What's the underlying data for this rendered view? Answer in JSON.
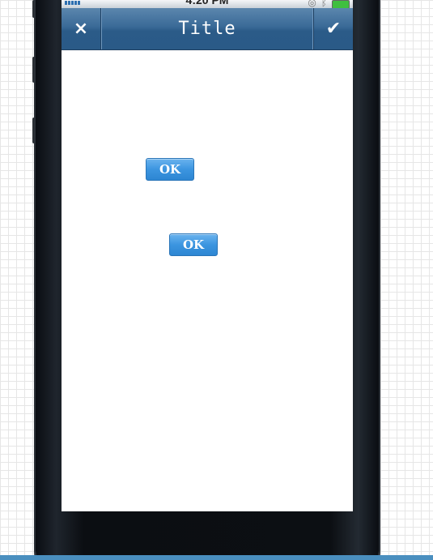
{
  "status_bar": {
    "time": "4:20 PM"
  },
  "navbar": {
    "title": "Title",
    "cancel_icon": "×",
    "confirm_icon": "✔"
  },
  "buttons": {
    "ok_1": "OK",
    "ok_2": "OK"
  },
  "icons": {
    "cancel": "close-icon",
    "confirm": "checkmark-icon",
    "signal": "signal-icon",
    "battery": "battery-icon"
  },
  "colors": {
    "navbar": "#3a6a97",
    "button": "#3c95e0",
    "battery": "#3fbf3f"
  }
}
